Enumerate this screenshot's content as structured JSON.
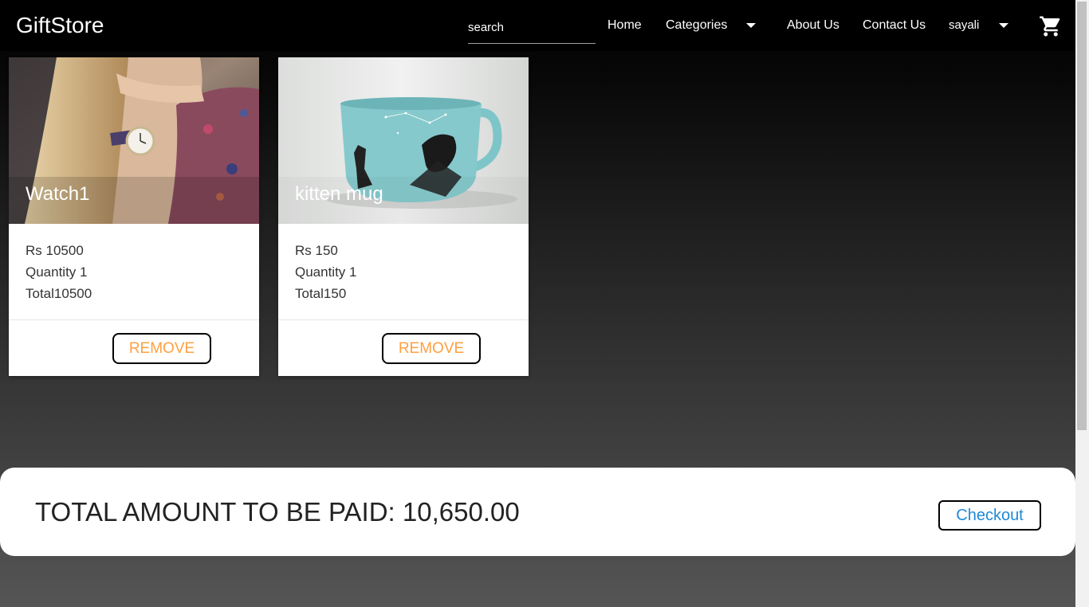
{
  "navbar": {
    "brand": "GiftStore",
    "search_placeholder": "search",
    "items": {
      "home": "Home",
      "categories": "Categories",
      "about": "About Us",
      "contact": "Contact Us",
      "user": "sayali"
    },
    "icons": {
      "categories_dropdown": "caret-down-icon",
      "user_dropdown": "caret-down-icon",
      "cart": "shopping-cart-icon"
    }
  },
  "cart_items": [
    {
      "title": "Watch1",
      "price": "Rs 10500",
      "quantity": "Quantity 1",
      "total": "Total10500",
      "remove_label": "REMOVE"
    },
    {
      "title": "kitten mug",
      "price": "Rs 150",
      "quantity": "Quantity 1",
      "total": "Total150",
      "remove_label": "REMOVE"
    }
  ],
  "summary": {
    "total_text": "TOTAL AMOUNT TO BE PAID: 10,650.00",
    "checkout_label": "Checkout"
  },
  "colors": {
    "remove_text": "#ffa040",
    "checkout_text": "#1e8ad6",
    "navbar_bg": "#000000"
  }
}
